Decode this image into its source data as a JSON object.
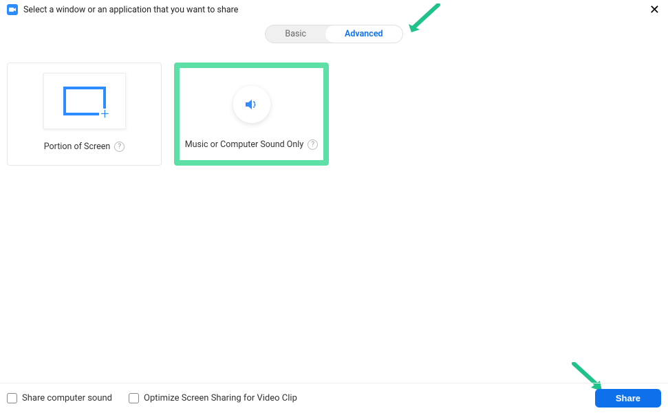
{
  "header": {
    "title": "Select a window or an application that you want to share"
  },
  "tabs": {
    "basic": "Basic",
    "advanced": "Advanced"
  },
  "options": {
    "portion": {
      "label": "Portion of Screen"
    },
    "music": {
      "label": "Music or Computer Sound Only"
    }
  },
  "footer": {
    "share_sound": "Share computer sound",
    "optimize_video": "Optimize Screen Sharing for Video Clip",
    "share_button": "Share"
  }
}
